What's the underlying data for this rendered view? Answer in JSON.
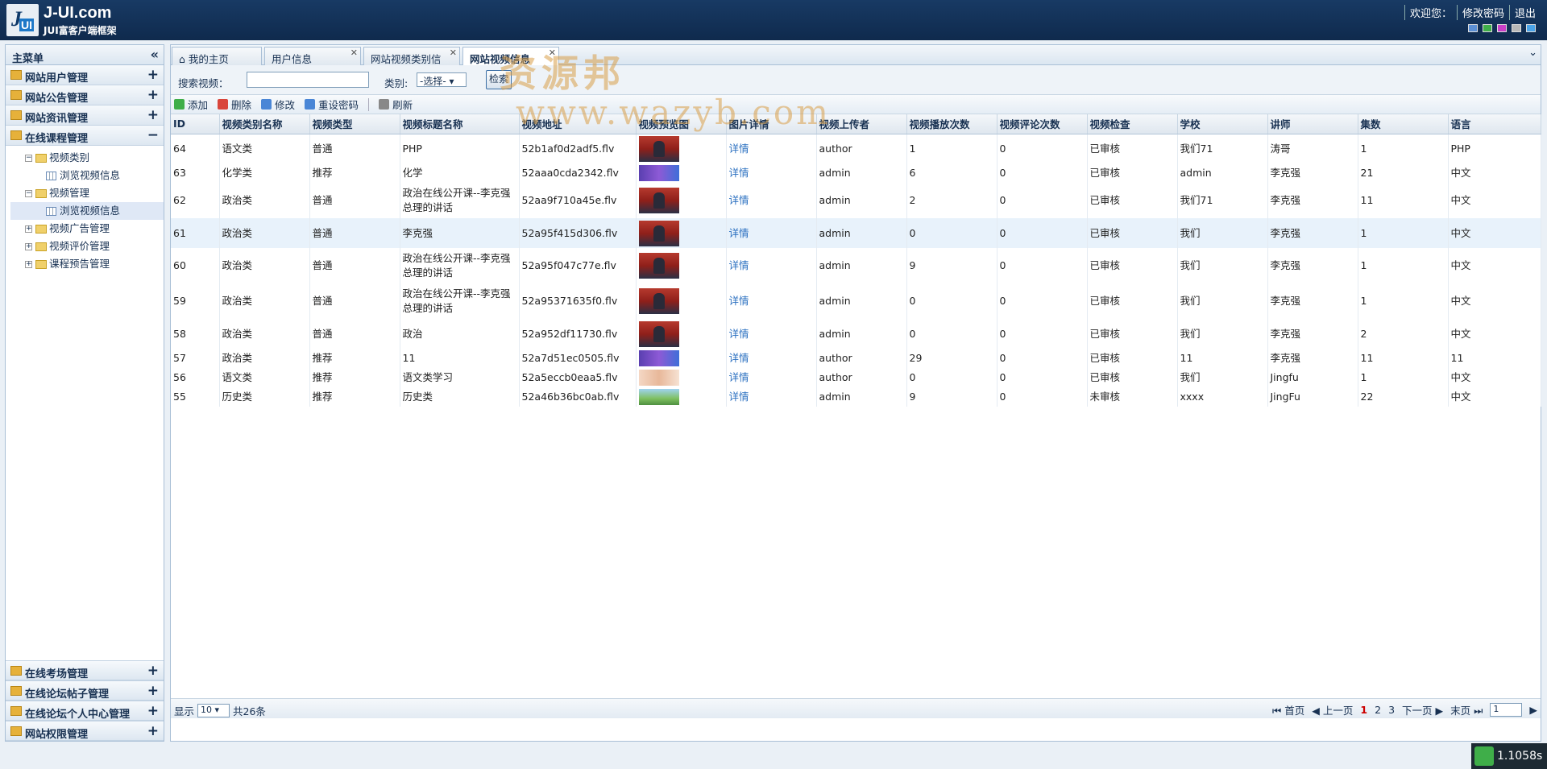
{
  "header": {
    "logo_main": "J-UI.com",
    "logo_sub": "JUI富客户端框架",
    "logo_letters": "J",
    "logo_badge": "UI",
    "nav": [
      "欢迎您：",
      "修改密码",
      "退出"
    ],
    "theme_colors": [
      "#5b8fd4",
      "#3fae49",
      "#c83fc8",
      "#b8b8b8",
      "#4aa3e8"
    ]
  },
  "sidebar": {
    "title": "主菜单",
    "collapse_icon": "«",
    "top_menus": [
      "网站用户管理",
      "网站公告管理",
      "网站资讯管理",
      "在线课程管理"
    ],
    "tree": [
      {
        "label": "视频类别",
        "level": 2,
        "toggle": "−"
      },
      {
        "label": "浏览视频信息",
        "level": 3
      },
      {
        "label": "视频管理",
        "level": 2,
        "toggle": "−"
      },
      {
        "label": "浏览视频信息",
        "level": 3,
        "selected": true
      },
      {
        "label": "视频广告管理",
        "level": 2,
        "toggle": "+"
      },
      {
        "label": "视频评价管理",
        "level": 2,
        "toggle": "+"
      },
      {
        "label": "课程预告管理",
        "level": 2,
        "toggle": "+"
      }
    ],
    "bottom_menus": [
      "在线考场管理",
      "在线论坛帖子管理",
      "在线论坛个人中心管理",
      "网站权限管理"
    ]
  },
  "tabs": [
    "我的主页",
    "用户信息",
    "网站视频类别信",
    "网站视频信息"
  ],
  "search": {
    "label": "搜索视频：",
    "category_label": "类别:",
    "select_value": "-选择-",
    "button": "检索"
  },
  "toolbar": [
    "添加",
    "删除",
    "修改",
    "重设密码",
    "刷新"
  ],
  "table": {
    "columns": [
      "ID",
      "视频类别名称",
      "视频类型",
      "视频标题名称",
      "视频地址",
      "视频预览图",
      "图片详情",
      "视频上传者",
      "视频播放次数",
      "视频评论次数",
      "视频检查",
      "学校",
      "讲师",
      "集数",
      "语言"
    ],
    "rows": [
      {
        "id": "64",
        "cat": "语文类",
        "type": "普通",
        "title": "PHP",
        "url": "52b1af0d2adf5.flv",
        "thumb": "tall",
        "detail": "详情",
        "uploader": "author",
        "plays": "1",
        "comments": "0",
        "check": "已审核",
        "school": "我们71",
        "teacher": "涛哥",
        "eps": "1",
        "lang": "PHP",
        "h": "r1"
      },
      {
        "id": "63",
        "cat": "化学类",
        "type": "推荐",
        "title": "化学",
        "url": "52aaa0cda2342.flv",
        "thumb": "blue",
        "detail": "详情",
        "uploader": "admin",
        "plays": "6",
        "comments": "0",
        "check": "已审核",
        "school": "admin",
        "teacher": "李克强",
        "eps": "21",
        "lang": "中文",
        "h": "r3"
      },
      {
        "id": "62",
        "cat": "政治类",
        "type": "普通",
        "title": "政治在线公开课--李克强总理的讲话",
        "url": "52aa9f710a45e.flv",
        "thumb": "tall",
        "detail": "详情",
        "uploader": "admin",
        "plays": "2",
        "comments": "0",
        "check": "已审核",
        "school": "我们71",
        "teacher": "李克强",
        "eps": "11",
        "lang": "中文",
        "h": "r2"
      },
      {
        "id": "61",
        "cat": "政治类",
        "type": "普通",
        "title": "李克强",
        "url": "52a95f415d306.flv",
        "thumb": "tall",
        "detail": "详情",
        "uploader": "admin",
        "plays": "0",
        "comments": "0",
        "check": "已审核",
        "school": "我们",
        "teacher": "李克强",
        "eps": "1",
        "lang": "中文",
        "h": "r1",
        "hl": true
      },
      {
        "id": "60",
        "cat": "政治类",
        "type": "普通",
        "title": "政治在线公开课--李克强总理的讲话",
        "url": "52a95f047c77e.flv",
        "thumb": "tall",
        "detail": "详情",
        "uploader": "admin",
        "plays": "9",
        "comments": "0",
        "check": "已审核",
        "school": "我们",
        "teacher": "李克强",
        "eps": "1",
        "lang": "中文",
        "h": "r2"
      },
      {
        "id": "59",
        "cat": "政治类",
        "type": "普通",
        "title": "政治在线公开课--李克强总理的讲话",
        "url": "52a95371635f0.flv",
        "thumb": "tall",
        "detail": "详情",
        "uploader": "admin",
        "plays": "0",
        "comments": "0",
        "check": "已审核",
        "school": "我们",
        "teacher": "李克强",
        "eps": "1",
        "lang": "中文",
        "h": "r2"
      },
      {
        "id": "58",
        "cat": "政治类",
        "type": "普通",
        "title": "政治",
        "url": "52a952df11730.flv",
        "thumb": "tall",
        "detail": "详情",
        "uploader": "admin",
        "plays": "0",
        "comments": "0",
        "check": "已审核",
        "school": "我们",
        "teacher": "李克强",
        "eps": "2",
        "lang": "中文",
        "h": "r1"
      },
      {
        "id": "57",
        "cat": "政治类",
        "type": "推荐",
        "title": "11",
        "url": "52a7d51ec0505.flv",
        "thumb": "blue",
        "detail": "详情",
        "uploader": "author",
        "plays": "29",
        "comments": "0",
        "check": "已审核",
        "school": "11",
        "teacher": "李克强",
        "eps": "11",
        "lang": "11",
        "h": "r3"
      },
      {
        "id": "56",
        "cat": "语文类",
        "type": "推荐",
        "title": "语文类学习",
        "url": "52a5eccb0eaa5.flv",
        "thumb": "pink",
        "detail": "详情",
        "uploader": "author",
        "plays": "0",
        "comments": "0",
        "check": "已审核",
        "school": "我们",
        "teacher": "Jingfu",
        "eps": "1",
        "lang": "中文",
        "h": "r3"
      },
      {
        "id": "55",
        "cat": "历史类",
        "type": "推荐",
        "title": "历史类",
        "url": "52a46b36bc0ab.flv",
        "thumb": "land",
        "detail": "详情",
        "uploader": "admin",
        "plays": "9",
        "comments": "0",
        "check": "未审核",
        "school": "xxxx",
        "teacher": "JingFu",
        "eps": "22",
        "lang": "中文",
        "h": "r3"
      }
    ]
  },
  "pager": {
    "show_label": "显示",
    "page_size": "10",
    "total": "共26条",
    "first": "首页",
    "prev": "上一页",
    "pages": [
      "1",
      "2",
      "3"
    ],
    "next": "下一页",
    "last": "末页",
    "page_input": "1"
  },
  "watermark": {
    "line1": "资源邦",
    "line2": "www.wazyb.com"
  },
  "timer": "1.1058s"
}
